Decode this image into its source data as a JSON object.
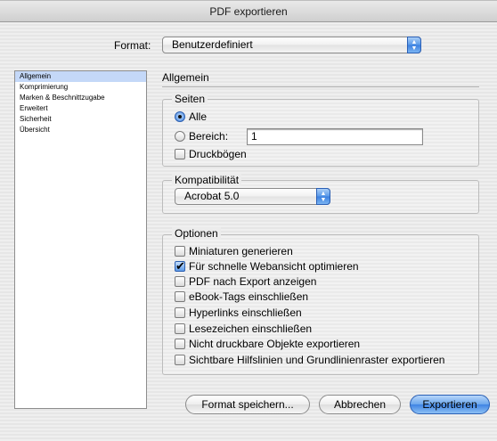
{
  "window": {
    "title": "PDF exportieren"
  },
  "format": {
    "label": "Format:",
    "value": "Benutzerdefiniert"
  },
  "sidebar": {
    "items": [
      {
        "label": "Allgemein",
        "selected": true
      },
      {
        "label": "Komprimierung",
        "selected": false
      },
      {
        "label": "Marken & Beschnittzugabe",
        "selected": false
      },
      {
        "label": "Erweitert",
        "selected": false
      },
      {
        "label": "Sicherheit",
        "selected": false
      },
      {
        "label": "Übersicht",
        "selected": false
      }
    ]
  },
  "main": {
    "section_title": "Allgemein",
    "seiten": {
      "caption": "Seiten",
      "alle_label": "Alle",
      "bereich_label": "Bereich:",
      "bereich_value": "1",
      "druckboegen_label": "Druckbögen",
      "selected": "Alle",
      "druckboegen_checked": false
    },
    "kompatibilitaet": {
      "caption": "Kompatibilität",
      "value": "Acrobat 5.0"
    },
    "optionen": {
      "caption": "Optionen",
      "items": [
        {
          "label": "Miniaturen generieren",
          "checked": false
        },
        {
          "label": "Für schnelle Webansicht optimieren",
          "checked": true
        },
        {
          "label": "PDF nach Export anzeigen",
          "checked": false
        },
        {
          "label": "eBook-Tags einschließen",
          "checked": false
        },
        {
          "label": "Hyperlinks einschließen",
          "checked": false
        },
        {
          "label": "Lesezeichen einschließen",
          "checked": false
        },
        {
          "label": "Nicht druckbare Objekte exportieren",
          "checked": false
        },
        {
          "label": "Sichtbare Hilfslinien und Grundlinienraster exportieren",
          "checked": false
        }
      ]
    }
  },
  "buttons": {
    "save_format": "Format speichern...",
    "cancel": "Abbrechen",
    "export": "Exportieren"
  },
  "icons": {
    "popup_arrows": "updown-arrows-icon",
    "checkmark": "checkmark-icon"
  },
  "colors": {
    "accent": "#3f83e3",
    "sidebar_selection": "#c4d8f8"
  }
}
